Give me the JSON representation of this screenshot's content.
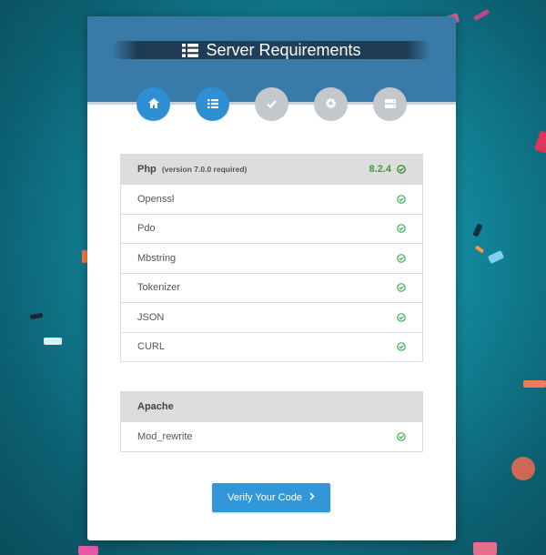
{
  "header": {
    "title": "Server Requirements"
  },
  "steps": [
    {
      "icon": "home-icon",
      "state": "active"
    },
    {
      "icon": "list-icon",
      "state": "active"
    },
    {
      "icon": "check-icon",
      "state": "inactive"
    },
    {
      "icon": "gear-icon",
      "state": "inactive"
    },
    {
      "icon": "server-icon",
      "state": "inactive"
    }
  ],
  "php": {
    "label": "Php",
    "requirement": "(version 7.0.0 required)",
    "version": "8.2.4",
    "extensions": [
      "Openssl",
      "Pdo",
      "Mbstring",
      "Tokenizer",
      "JSON",
      "CURL"
    ]
  },
  "apache": {
    "label": "Apache",
    "modules": [
      "Mod_rewrite"
    ]
  },
  "actions": {
    "verify_label": "Verify Your Code",
    "verify_icon": "chevron-right-icon"
  },
  "colors": {
    "header": "#3a7aa8",
    "step_active": "#2f8fd3",
    "step_inactive": "#c4c8cc",
    "ok": "#3a9c3a",
    "button": "#3197d8"
  }
}
